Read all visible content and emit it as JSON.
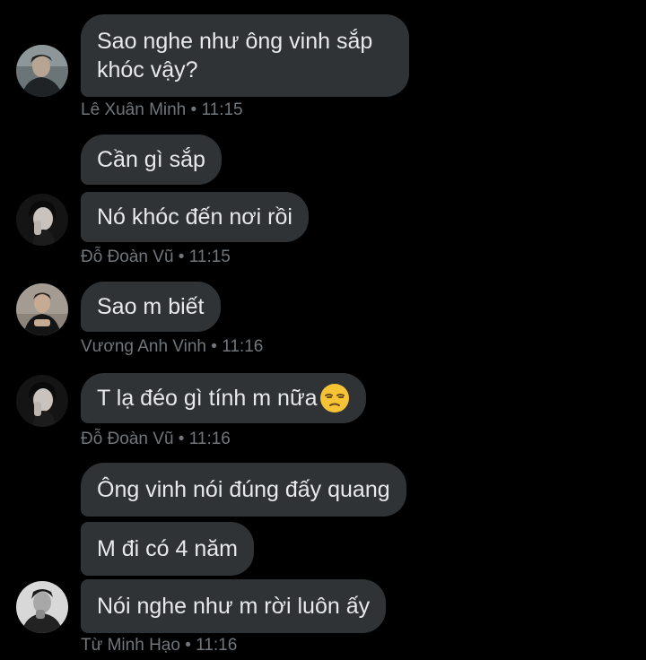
{
  "messages": [
    {
      "text": "Sao nghe như ông vinh sắp khóc vậy?"
    },
    {
      "text": "Cần gì sắp"
    },
    {
      "text": "Nó khóc đến nơi rồi"
    },
    {
      "text": "Sao m biết"
    },
    {
      "text": "T lạ đéo gì tính m nữa",
      "emoji": "unamused-face-icon"
    },
    {
      "text": "Ông vinh nói đúng đấy quang"
    },
    {
      "text": "M đi có 4 năm"
    },
    {
      "text": "Nói nghe như m rời luôn ấy"
    }
  ],
  "meta": [
    {
      "name": "Lê Xuân Minh",
      "time": "11:15"
    },
    {
      "name": "Đỗ Đoàn Vũ",
      "time": "11:15"
    },
    {
      "name": "Vương Anh Vinh",
      "time": "11:16"
    },
    {
      "name": "Đỗ Đoàn Vũ",
      "time": "11:16"
    },
    {
      "name": "Từ Minh Hạo",
      "time": "11:16"
    }
  ],
  "separator": "•",
  "colors": {
    "background": "#000000",
    "bubble": "#2f3336",
    "text": "#e7e9ea",
    "meta": "#71767b"
  }
}
